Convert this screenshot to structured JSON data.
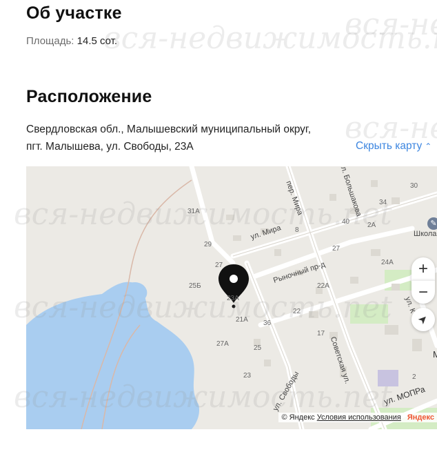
{
  "about": {
    "title": "Об участке",
    "area_label": "Площадь:",
    "area_value": "14.5 сот."
  },
  "location": {
    "title": "Расположение",
    "address_line1": "Свердловская обл., Малышевский муниципальный округ,",
    "address_line2": "пгт. Малышева, ул. Свободы, 23А",
    "toggle_label": "Скрыть карту"
  },
  "map": {
    "streets": [
      "ул. Мира",
      "пер. Мира",
      "Рыночный пр-д",
      "ул. Большакова",
      "Советская ул.",
      "ул. Свободы",
      "ул. МОПРа",
      "ул. К"
    ],
    "house_numbers": [
      "31А",
      "29",
      "27",
      "25Б",
      "23А",
      "21А",
      "27А",
      "25",
      "23",
      "36",
      "8",
      "22",
      "22А",
      "27",
      "17",
      "40",
      "2А",
      "24А",
      "34",
      "30",
      "М",
      "2"
    ],
    "poi": "Школа",
    "zoom_in": "+",
    "zoom_out": "−",
    "copyright": "© Яндекс",
    "terms": "Условия использования",
    "brand": "Яндекс"
  },
  "watermark": "вся-недвижимость.net",
  "colors": {
    "accent": "#3d86e0",
    "water": "#a9cdf0",
    "park": "#d4ecc4",
    "road": "#ffffff",
    "pin": "#111111"
  },
  "icons": [
    "chevron-up-icon",
    "map-pin-icon",
    "geolocation-icon",
    "school-icon"
  ]
}
